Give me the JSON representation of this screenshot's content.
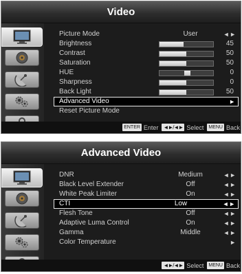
{
  "video_menu": {
    "title": "Video",
    "items": [
      {
        "label": "Picture Mode",
        "value": "User",
        "arrows": "◄ ►"
      },
      {
        "label": "Brightness",
        "num": "45",
        "level": 45
      },
      {
        "label": "Contrast",
        "num": "50",
        "level": 50
      },
      {
        "label": "Saturation",
        "num": "50",
        "level": 50
      },
      {
        "label": "HUE",
        "num": "0",
        "level": 0
      },
      {
        "label": "Sharpness",
        "num": "0",
        "level": 0
      },
      {
        "label": "Back Light",
        "num": "50",
        "level": 50
      },
      {
        "label": "Advanced Video",
        "arrows": "►"
      },
      {
        "label": "Reset Picture Mode"
      }
    ],
    "footer": {
      "enter_key": "ENTER",
      "enter_label": "Enter",
      "nav_key": "◄►/◄►",
      "select_label": "Select",
      "menu_key": "MENU",
      "back_label": "Back"
    }
  },
  "advanced_menu": {
    "title": "Advanced Video",
    "items": [
      {
        "label": "DNR",
        "value": "Medium",
        "arrows": "◄ ►"
      },
      {
        "label": "Black Level Extender",
        "value": "Off",
        "arrows": "◄ ►"
      },
      {
        "label": "White Peak Limiter",
        "value": "On",
        "arrows": "◄ ►"
      },
      {
        "label": "CTI",
        "value": "Low",
        "arrows": "◄ ►"
      },
      {
        "label": "Flesh Tone",
        "value": "Off",
        "arrows": "◄ ►"
      },
      {
        "label": "Adaptive Luma Control",
        "value": "On",
        "arrows": "◄ ►"
      },
      {
        "label": "Gamma",
        "value": "Middle",
        "arrows": "◄ ►"
      },
      {
        "label": "Color Temperature",
        "arrows": "►"
      }
    ],
    "footer": {
      "nav_key": "◄►/◄►",
      "select_label": "Select",
      "menu_key": "MENU",
      "back_label": "Back"
    }
  },
  "sidebar_icons": [
    "monitor-icon",
    "speaker-icon",
    "satellite-dish-icon",
    "settings-gears-icon",
    "lock-icon"
  ]
}
